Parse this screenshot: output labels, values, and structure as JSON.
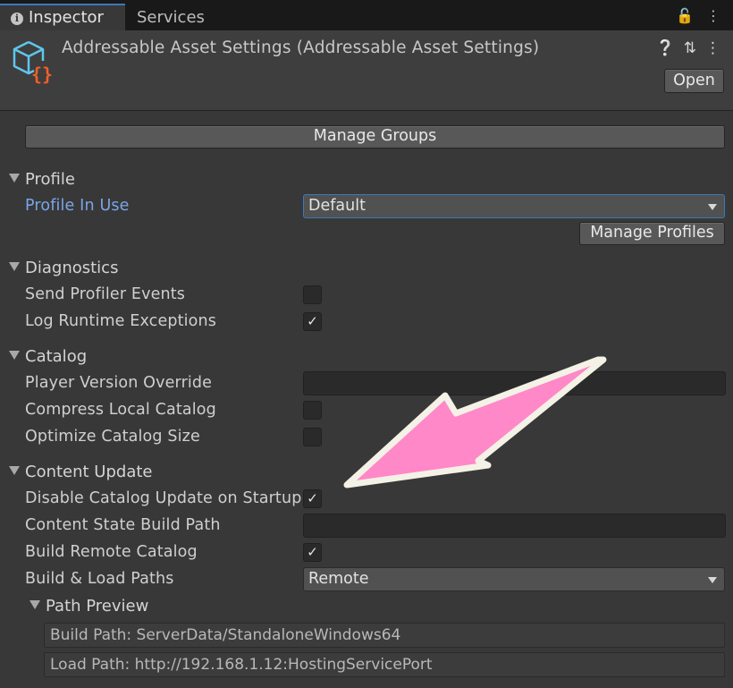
{
  "tabs": {
    "inspector": "Inspector",
    "services": "Services"
  },
  "header": {
    "title": "Addressable Asset Settings (Addressable Asset Settings)",
    "open_label": "Open"
  },
  "buttons": {
    "manage_groups": "Manage Groups",
    "manage_profiles": "Manage Profiles"
  },
  "profile": {
    "section": "Profile",
    "profile_in_use_label": "Profile In Use",
    "profile_in_use_value": "Default"
  },
  "diagnostics": {
    "section": "Diagnostics",
    "send_profiler_events": {
      "label": "Send Profiler Events",
      "checked": false
    },
    "log_runtime_exceptions": {
      "label": "Log Runtime Exceptions",
      "checked": true
    }
  },
  "catalog": {
    "section": "Catalog",
    "player_version_override": {
      "label": "Player Version Override",
      "value": ""
    },
    "compress_local_catalog": {
      "label": "Compress Local Catalog",
      "checked": false
    },
    "optimize_catalog_size": {
      "label": "Optimize Catalog Size",
      "checked": false
    }
  },
  "content_update": {
    "section": "Content Update",
    "disable_catalog_update": {
      "label": "Disable Catalog Update on Startup",
      "checked": true
    },
    "content_state_build_path": {
      "label": "Content State Build Path",
      "value": ""
    },
    "build_remote_catalog": {
      "label": "Build Remote Catalog",
      "checked": true
    },
    "build_load_paths": {
      "label": "Build & Load Paths",
      "value": "Remote"
    },
    "path_preview": {
      "section": "Path Preview",
      "build_path": "Build Path: ServerData/StandaloneWindows64",
      "load_path": "Load Path: http://192.168.1.12:HostingServicePort"
    }
  },
  "icons": {
    "info": "info-icon",
    "lock": "lock-icon",
    "menu": "kebab-menu-icon",
    "help": "help-icon",
    "settings": "preset-sliders-icon",
    "asset": "addressable-settings-icon",
    "annotation": "pink-arrow"
  },
  "colors": {
    "accent_blue": "#3a79bb",
    "link_blue": "#7aa5e8",
    "arrow_pink": "#ff88c8",
    "background": "#383838"
  }
}
